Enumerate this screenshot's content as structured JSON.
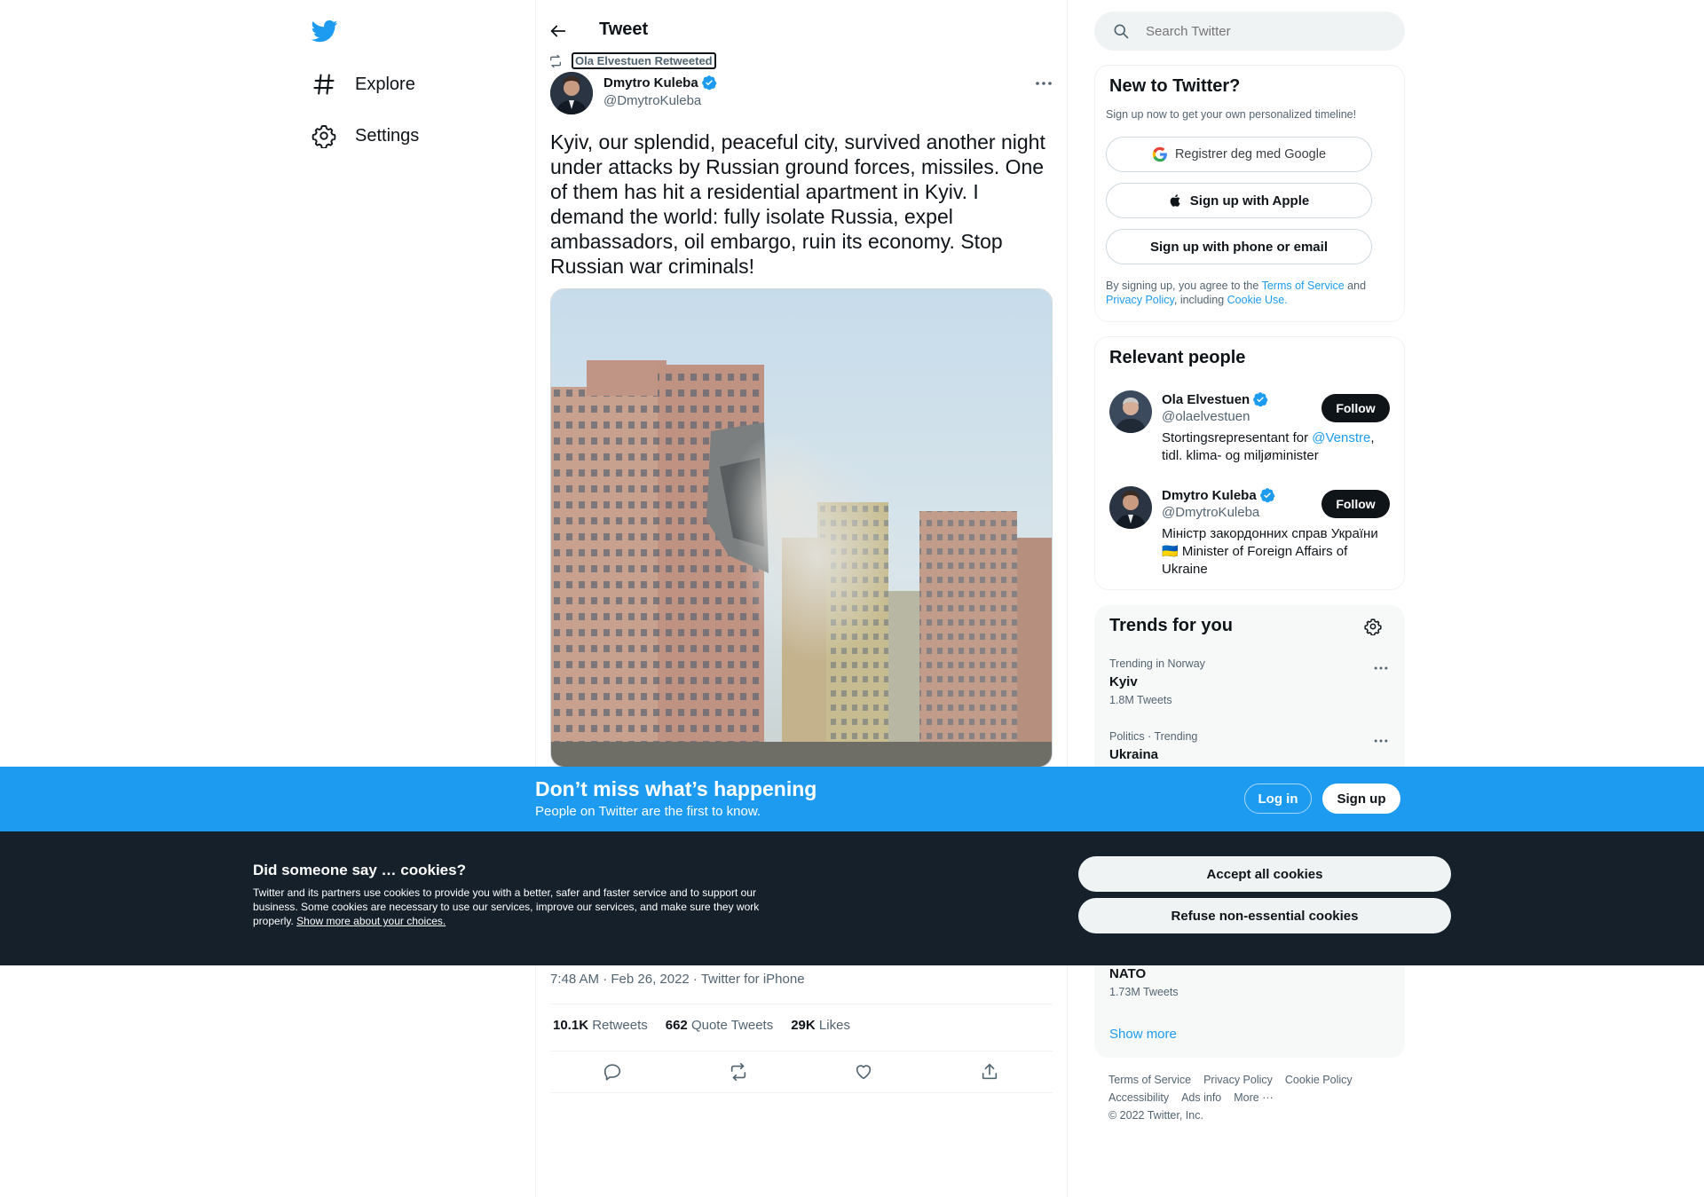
{
  "nav": {
    "items": [
      {
        "label": "Explore",
        "icon": "hashtag-icon"
      },
      {
        "label": "Settings",
        "icon": "gear-icon"
      }
    ]
  },
  "header": {
    "title": "Tweet"
  },
  "tweet": {
    "retweet_context": "Ola Elvestuen Retweeted",
    "author_name": "Dmytro Kuleba",
    "author_handle": "@DmytroKuleba",
    "text": "Kyiv, our splendid, peaceful city, survived another night under attacks by Russian ground forces, missiles. One of them has hit a residential apartment in Kyiv. I demand the world: fully isolate Russia, expel ambassadors, oil embargo, ruin its economy. Stop Russian war criminals!",
    "meta": "7:48 AM · Feb 26, 2022 · Twitter for iPhone",
    "retweets_count": "10.1K",
    "retweets_label": "Retweets",
    "quotes_count": "662",
    "quotes_label": "Quote Tweets",
    "likes_count": "29K",
    "likes_label": "Likes"
  },
  "search": {
    "placeholder": "Search Twitter"
  },
  "new_to_twitter": {
    "title": "New to Twitter?",
    "subtitle": "Sign up now to get your own personalized timeline!",
    "google_label": "Registrer deg med Google",
    "apple_label": "Sign up with Apple",
    "phone_label": "Sign up with phone or email",
    "legal_prefix": "By signing up, you agree to the ",
    "terms_link": "Terms of Service",
    "legal_and": " and",
    "privacy_link": "Privacy Policy",
    "legal_including": ", including ",
    "cookie_link": "Cookie Use."
  },
  "relevant_people": {
    "title": "Relevant people",
    "people": [
      {
        "name": "Ola Elvestuen",
        "handle": "@olaelvestuen",
        "bio_prefix": "Stortingsrepresentant for ",
        "bio_link": "@Venstre",
        "bio_suffix": ", tidl. klima- og miljøminister",
        "follow_label": "Follow"
      },
      {
        "name": "Dmytro Kuleba",
        "handle": "@DmytroKuleba",
        "bio": "Міністр закордонних справ України 🇺🇦 Minister of Foreign Affairs of Ukraine",
        "follow_label": "Follow"
      }
    ]
  },
  "trends": {
    "title": "Trends for you",
    "items": [
      {
        "context": "Trending in Norway",
        "name": "Kyiv",
        "count": "1.8M Tweets"
      },
      {
        "context": "Politics · Trending",
        "name": "Ukraina",
        "count": ""
      },
      {
        "context": "",
        "name": "NATO",
        "count": "1.73M Tweets"
      }
    ],
    "show_more": "Show more"
  },
  "footer": {
    "links": [
      "Terms of Service",
      "Privacy Policy",
      "Cookie Policy",
      "Accessibility",
      "Ads info",
      "More ···"
    ],
    "copyright": "© 2022 Twitter, Inc."
  },
  "banner": {
    "title": "Don’t miss what’s happening",
    "subtitle": "People on Twitter are the first to know.",
    "login_label": "Log in",
    "signup_label": "Sign up"
  },
  "cookies": {
    "title": "Did someone say … cookies?",
    "text": "Twitter and its partners use cookies to provide you with a better, safer and faster service and to support our business. Some cookies are necessary to use our services, improve our services, and make sure they work properly. ",
    "link": "Show more about your choices.",
    "accept_label": "Accept all cookies",
    "refuse_label": "Refuse non-essential cookies"
  },
  "colors": {
    "brand_blue": "#1d9bf0",
    "text_primary": "#0f1419",
    "text_secondary": "#536471",
    "cookie_bg": "#15202b"
  }
}
